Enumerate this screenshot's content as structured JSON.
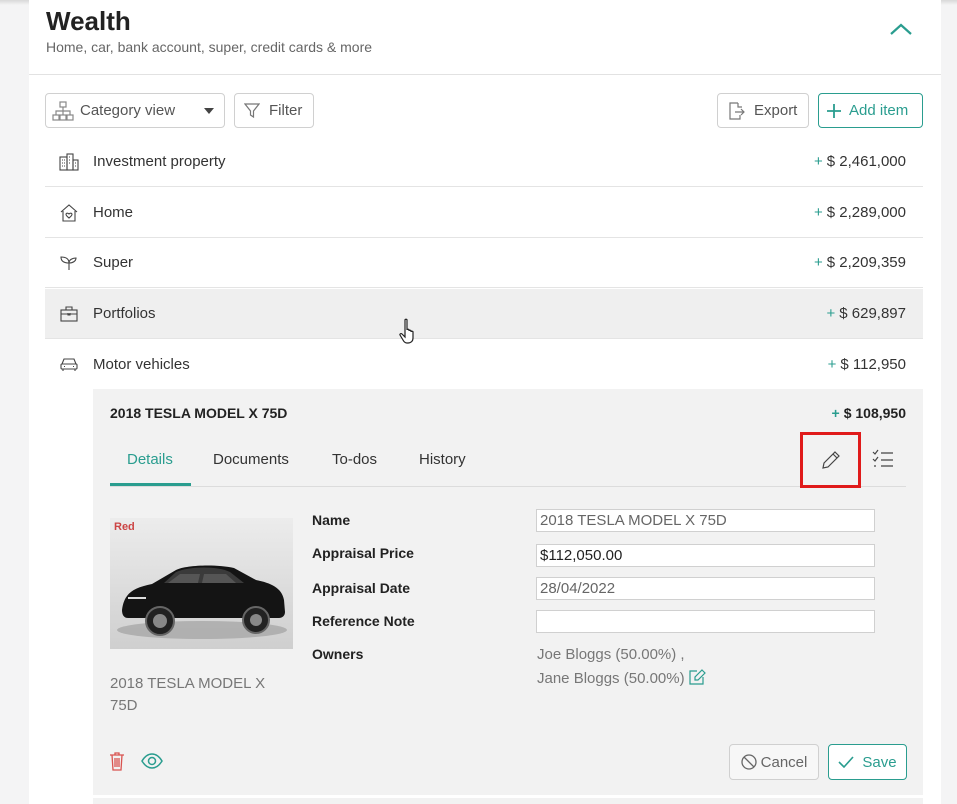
{
  "colors": {
    "accent": "#2a9d8f",
    "highlight": "#e01b1b"
  },
  "header": {
    "title": "Wealth",
    "subtitle": "Home, car, bank account, super, credit cards & more",
    "collapse_icon": "chevron-up-icon"
  },
  "toolbar": {
    "view_select": "Category view",
    "filter_label": "Filter",
    "export_label": "Export",
    "add_label": "Add item"
  },
  "categories": [
    {
      "label": "Investment property",
      "sign": "+",
      "amount": "$ 2,461,000",
      "icon": "buildings-icon"
    },
    {
      "label": "Home",
      "sign": "+",
      "amount": "$ 2,289,000",
      "icon": "home-icon"
    },
    {
      "label": "Super",
      "sign": "+",
      "amount": "$ 2,209,359",
      "icon": "sprout-icon"
    },
    {
      "label": "Portfolios",
      "sign": "+",
      "amount": "$ 629,897",
      "icon": "briefcase-icon"
    },
    {
      "label": "Motor vehicles",
      "sign": "+",
      "amount": "$ 112,950",
      "icon": "car-icon"
    }
  ],
  "item": {
    "title": "2018 TESLA MODEL X 75D",
    "sign": "+",
    "amount": "$ 108,950",
    "tabs": [
      "Details",
      "Documents",
      "To-dos",
      "History"
    ],
    "image_caption": "2018 TESLA MODEL X 75D",
    "image_tag": "Red",
    "fields": {
      "name_label": "Name",
      "name_value": "2018 TESLA MODEL X  75D",
      "price_label": "Appraisal Price",
      "price_value": "$112,050.00",
      "date_label": "Appraisal Date",
      "date_value": "28/04/2022",
      "note_label": "Reference Note",
      "note_value": "",
      "owners_label": "Owners",
      "owner_1": "Joe Bloggs (50.00%) ,",
      "owner_2": "Jane Bloggs (50.00%)"
    },
    "cancel_label": "Cancel",
    "save_label": "Save"
  }
}
